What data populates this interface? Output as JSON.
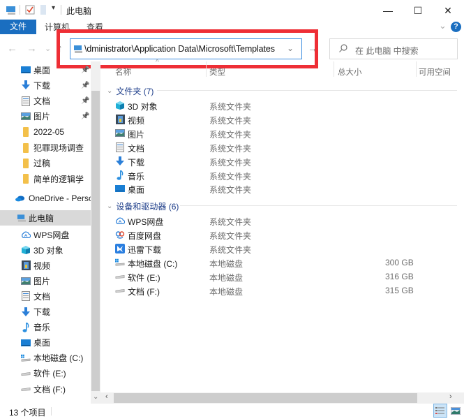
{
  "window": {
    "title": "此电脑",
    "minimize_label": "—",
    "maximize_label": "☐",
    "close_label": "✕"
  },
  "ribbon": {
    "tabs": [
      {
        "label": "文件",
        "active": true
      },
      {
        "label": "计算机"
      },
      {
        "label": "查看"
      }
    ],
    "expand_label": "⌄",
    "help_label": "?"
  },
  "nav": {
    "back": "←",
    "forward": "→",
    "recent": "⌄",
    "up": "↑",
    "address_value": "\\dministrator\\Application Data\\Microsoft\\Templates",
    "dropdown": "⌄",
    "go": "→",
    "search_placeholder": "在 此电脑 中搜索"
  },
  "sidebar": {
    "quick_access": [
      {
        "label": "桌面",
        "icon": "desktop-icon",
        "pinned": true
      },
      {
        "label": "下载",
        "icon": "download-icon",
        "pinned": true
      },
      {
        "label": "文档",
        "icon": "document-icon",
        "pinned": true
      },
      {
        "label": "图片",
        "icon": "picture-icon",
        "pinned": true
      },
      {
        "label": "2022-05",
        "icon": "folder-icon"
      },
      {
        "label": "犯罪现场调查",
        "icon": "folder-icon"
      },
      {
        "label": "过稿",
        "icon": "folder-icon"
      },
      {
        "label": "简单的逻辑学",
        "icon": "folder-icon"
      }
    ],
    "onedrive": {
      "label": "OneDrive - Perso",
      "icon": "onedrive-icon"
    },
    "this_pc": {
      "label": "此电脑",
      "icon": "computer-icon",
      "selected": true
    },
    "pc_items": [
      {
        "label": "WPS网盘",
        "icon": "cloud-icon"
      },
      {
        "label": "3D 对象",
        "icon": "cube-icon"
      },
      {
        "label": "视频",
        "icon": "video-icon"
      },
      {
        "label": "图片",
        "icon": "picture-icon"
      },
      {
        "label": "文档",
        "icon": "document-icon"
      },
      {
        "label": "下载",
        "icon": "download-icon"
      },
      {
        "label": "音乐",
        "icon": "music-icon"
      },
      {
        "label": "桌面",
        "icon": "desktop-icon"
      },
      {
        "label": "本地磁盘 (C:)",
        "icon": "system-drive-icon"
      },
      {
        "label": "软件 (E:)",
        "icon": "drive-icon"
      },
      {
        "label": "文档 (F:)",
        "icon": "drive-icon"
      }
    ]
  },
  "columns": {
    "name": "名称",
    "type": "类型",
    "total": "总大小",
    "free": "可用空间"
  },
  "groups": {
    "folders": {
      "label": "文件夹 (7)",
      "items": [
        {
          "name": "3D 对象",
          "type": "系统文件夹",
          "icon": "cube-icon"
        },
        {
          "name": "视频",
          "type": "系统文件夹",
          "icon": "video-icon"
        },
        {
          "name": "图片",
          "type": "系统文件夹",
          "icon": "picture-icon"
        },
        {
          "name": "文档",
          "type": "系统文件夹",
          "icon": "document-icon"
        },
        {
          "name": "下载",
          "type": "系统文件夹",
          "icon": "download-icon"
        },
        {
          "name": "音乐",
          "type": "系统文件夹",
          "icon": "music-icon"
        },
        {
          "name": "桌面",
          "type": "系统文件夹",
          "icon": "desktop-icon"
        }
      ]
    },
    "devices": {
      "label": "设备和驱动器 (6)",
      "items": [
        {
          "name": "WPS网盘",
          "type": "系统文件夹",
          "size": "",
          "icon": "cloud-icon"
        },
        {
          "name": "百度网盘",
          "type": "系统文件夹",
          "size": "",
          "icon": "baidu-netdisk-icon"
        },
        {
          "name": "迅雷下载",
          "type": "系统文件夹",
          "size": "",
          "icon": "thunder-icon"
        },
        {
          "name": "本地磁盘 (C:)",
          "type": "本地磁盘",
          "size": "300 GB",
          "icon": "system-drive-icon"
        },
        {
          "name": "软件 (E:)",
          "type": "本地磁盘",
          "size": "316 GB",
          "icon": "drive-icon"
        },
        {
          "name": "文档 (F:)",
          "type": "本地磁盘",
          "size": "315 GB",
          "icon": "drive-icon"
        }
      ]
    }
  },
  "status": {
    "item_count": "13 个项目"
  },
  "colors": {
    "accent": "#1a6ec0",
    "highlight_box": "#ee2e35",
    "group_header": "#1e3e8a"
  }
}
